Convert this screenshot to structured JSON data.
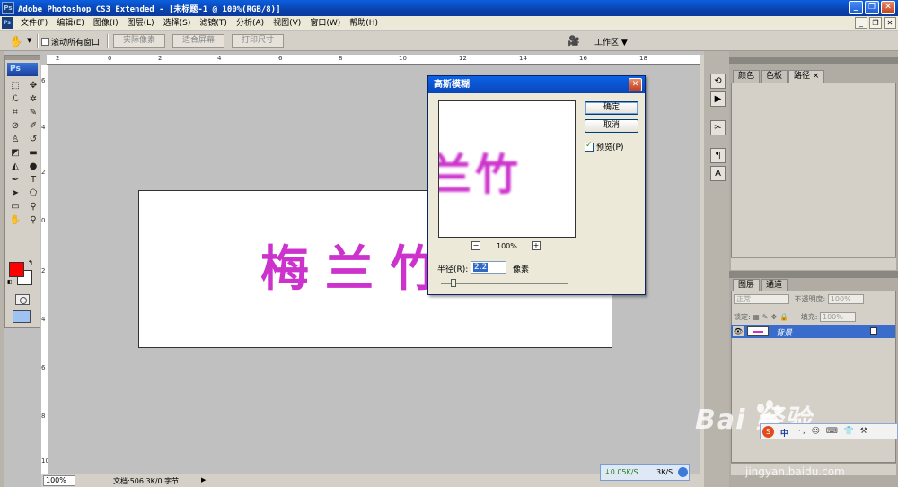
{
  "window": {
    "title": "Adobe Photoshop CS3 Extended - [未标题-1 @ 100%(RGB/8)]",
    "app_icon": "Ps",
    "min": "_",
    "restore": "❐",
    "close": "✕"
  },
  "menu": {
    "items": [
      "文件(F)",
      "编辑(E)",
      "图像(I)",
      "图层(L)",
      "选择(S)",
      "滤镜(T)",
      "分析(A)",
      "视图(V)",
      "窗口(W)",
      "帮助(H)"
    ],
    "doc_min": "_",
    "doc_restore": "❐",
    "doc_close": "✕"
  },
  "options": {
    "scroll_all_label": "滚动所有窗口",
    "actual_pixels": "实际像素",
    "fit_screen": "适合屏幕",
    "print_size": "打印尺寸",
    "workspace": "工作区 ▼"
  },
  "toolbox": {
    "logo": "Ps"
  },
  "ruler": {
    "h_ticks": [
      "2",
      "0",
      "2",
      "4",
      "6",
      "8",
      "10",
      "12",
      "14",
      "16",
      "18"
    ],
    "v_ticks": [
      "6",
      "4",
      "2",
      "0",
      "2",
      "4",
      "6",
      "8",
      "10"
    ]
  },
  "canvas": {
    "text": "梅兰竹",
    "text_color": "#cc33cc"
  },
  "status": {
    "zoom": "100%",
    "doc_info": "文档:506.3K/0 字节",
    "play": "▶"
  },
  "network": {
    "down": "↓0.05K/S",
    "up": "3K/S"
  },
  "panels": {
    "top_tabs": [
      "颜色",
      "色板",
      "路径"
    ],
    "top_tab_close": "×",
    "layer_tabs": [
      "图层",
      "通道"
    ],
    "blend_mode": "正常",
    "opacity_label": "不透明度:",
    "opacity_value": "100%",
    "lock_label": "锁定:",
    "fill_label": "填充:",
    "fill_value": "100%",
    "layer_name": "背景"
  },
  "dialog": {
    "title": "高斯模糊",
    "ok": "确定",
    "cancel": "取消",
    "preview_label": "预览(P)",
    "preview_checked": true,
    "zoom": "100%",
    "zoom_out": "−",
    "zoom_in": "+",
    "preview_text": "兰竹",
    "radius_label": "半径(R):",
    "radius_value": "2.2",
    "radius_unit": "像素",
    "slider_fraction": 0.1
  },
  "watermark": {
    "brand": "Bai  经验",
    "url": "jingyan.baidu.com"
  },
  "ime": {
    "logo": "S",
    "zh": "中",
    "rest": "·, ☺ ⌨ 👕 ⚒"
  }
}
